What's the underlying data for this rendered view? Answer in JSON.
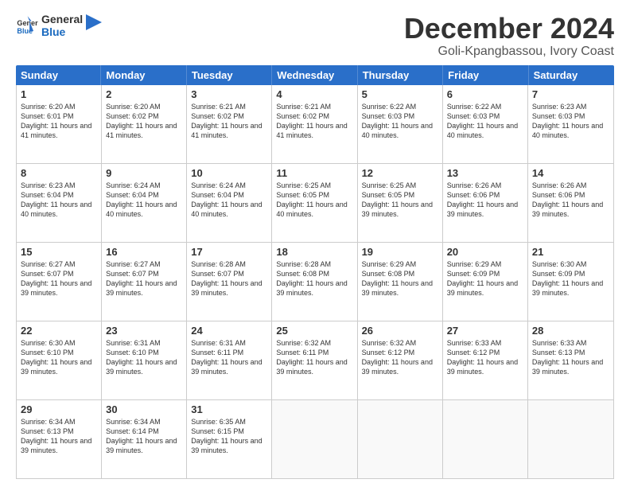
{
  "logo": {
    "line1": "General",
    "line2": "Blue"
  },
  "title": "December 2024",
  "subtitle": "Goli-Kpangbassou, Ivory Coast",
  "days": [
    "Sunday",
    "Monday",
    "Tuesday",
    "Wednesday",
    "Thursday",
    "Friday",
    "Saturday"
  ],
  "weeks": [
    [
      {
        "day": 1,
        "rise": "6:20 AM",
        "set": "6:01 PM",
        "daylight": "11 hours and 41 minutes"
      },
      {
        "day": 2,
        "rise": "6:20 AM",
        "set": "6:02 PM",
        "daylight": "11 hours and 41 minutes"
      },
      {
        "day": 3,
        "rise": "6:21 AM",
        "set": "6:02 PM",
        "daylight": "11 hours and 41 minutes"
      },
      {
        "day": 4,
        "rise": "6:21 AM",
        "set": "6:02 PM",
        "daylight": "11 hours and 41 minutes"
      },
      {
        "day": 5,
        "rise": "6:22 AM",
        "set": "6:03 PM",
        "daylight": "11 hours and 40 minutes"
      },
      {
        "day": 6,
        "rise": "6:22 AM",
        "set": "6:03 PM",
        "daylight": "11 hours and 40 minutes"
      },
      {
        "day": 7,
        "rise": "6:23 AM",
        "set": "6:03 PM",
        "daylight": "11 hours and 40 minutes"
      }
    ],
    [
      {
        "day": 8,
        "rise": "6:23 AM",
        "set": "6:04 PM",
        "daylight": "11 hours and 40 minutes"
      },
      {
        "day": 9,
        "rise": "6:24 AM",
        "set": "6:04 PM",
        "daylight": "11 hours and 40 minutes"
      },
      {
        "day": 10,
        "rise": "6:24 AM",
        "set": "6:04 PM",
        "daylight": "11 hours and 40 minutes"
      },
      {
        "day": 11,
        "rise": "6:25 AM",
        "set": "6:05 PM",
        "daylight": "11 hours and 40 minutes"
      },
      {
        "day": 12,
        "rise": "6:25 AM",
        "set": "6:05 PM",
        "daylight": "11 hours and 39 minutes"
      },
      {
        "day": 13,
        "rise": "6:26 AM",
        "set": "6:06 PM",
        "daylight": "11 hours and 39 minutes"
      },
      {
        "day": 14,
        "rise": "6:26 AM",
        "set": "6:06 PM",
        "daylight": "11 hours and 39 minutes"
      }
    ],
    [
      {
        "day": 15,
        "rise": "6:27 AM",
        "set": "6:07 PM",
        "daylight": "11 hours and 39 minutes"
      },
      {
        "day": 16,
        "rise": "6:27 AM",
        "set": "6:07 PM",
        "daylight": "11 hours and 39 minutes"
      },
      {
        "day": 17,
        "rise": "6:28 AM",
        "set": "6:07 PM",
        "daylight": "11 hours and 39 minutes"
      },
      {
        "day": 18,
        "rise": "6:28 AM",
        "set": "6:08 PM",
        "daylight": "11 hours and 39 minutes"
      },
      {
        "day": 19,
        "rise": "6:29 AM",
        "set": "6:08 PM",
        "daylight": "11 hours and 39 minutes"
      },
      {
        "day": 20,
        "rise": "6:29 AM",
        "set": "6:09 PM",
        "daylight": "11 hours and 39 minutes"
      },
      {
        "day": 21,
        "rise": "6:30 AM",
        "set": "6:09 PM",
        "daylight": "11 hours and 39 minutes"
      }
    ],
    [
      {
        "day": 22,
        "rise": "6:30 AM",
        "set": "6:10 PM",
        "daylight": "11 hours and 39 minutes"
      },
      {
        "day": 23,
        "rise": "6:31 AM",
        "set": "6:10 PM",
        "daylight": "11 hours and 39 minutes"
      },
      {
        "day": 24,
        "rise": "6:31 AM",
        "set": "6:11 PM",
        "daylight": "11 hours and 39 minutes"
      },
      {
        "day": 25,
        "rise": "6:32 AM",
        "set": "6:11 PM",
        "daylight": "11 hours and 39 minutes"
      },
      {
        "day": 26,
        "rise": "6:32 AM",
        "set": "6:12 PM",
        "daylight": "11 hours and 39 minutes"
      },
      {
        "day": 27,
        "rise": "6:33 AM",
        "set": "6:12 PM",
        "daylight": "11 hours and 39 minutes"
      },
      {
        "day": 28,
        "rise": "6:33 AM",
        "set": "6:13 PM",
        "daylight": "11 hours and 39 minutes"
      }
    ],
    [
      {
        "day": 29,
        "rise": "6:34 AM",
        "set": "6:13 PM",
        "daylight": "11 hours and 39 minutes"
      },
      {
        "day": 30,
        "rise": "6:34 AM",
        "set": "6:14 PM",
        "daylight": "11 hours and 39 minutes"
      },
      {
        "day": 31,
        "rise": "6:35 AM",
        "set": "6:15 PM",
        "daylight": "11 hours and 39 minutes"
      },
      null,
      null,
      null,
      null
    ]
  ]
}
